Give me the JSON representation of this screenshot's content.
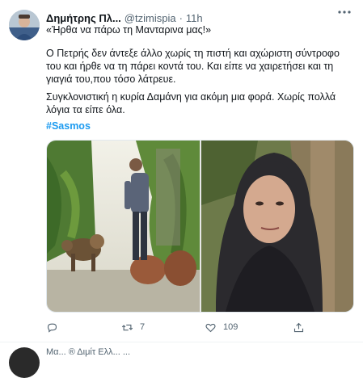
{
  "tweet": {
    "author_name": "Δημήτρης Πλ...",
    "handle": "@tzimispia",
    "separator": "·",
    "time": "11h",
    "reply_quote": "«Ήρθα να πάρω τη Μανταρινα μας!»",
    "paragraph1": "Ο Πετρής δεν άντεξε άλλο χωρίς τη πιστή και αχώριστη σύντροφο του και ήρθε να τη πάρει κοντά του. Και είπε να χαιρετήσει και τη γιαγιά του,που τόσο λάτρευε.",
    "paragraph2": "Συγκλονιστική η κυρία Δαμάνη για ακόμη μια φορά. Χωρίς πολλά λόγια τα είπε όλα.",
    "hashtag": "#Sasmos"
  },
  "actions": {
    "reply_icon": "reply-icon",
    "retweet_icon": "retweet-icon",
    "retweet_count": "7",
    "like_icon": "heart-icon",
    "like_count": "109",
    "share_icon": "share-icon"
  },
  "next_tweet": {
    "preview": "Μα...   ® Διμίτ Ελλ... ..."
  },
  "colors": {
    "link": "#1d9bf0",
    "secondary_text": "#536471",
    "primary_text": "#0f1419"
  }
}
